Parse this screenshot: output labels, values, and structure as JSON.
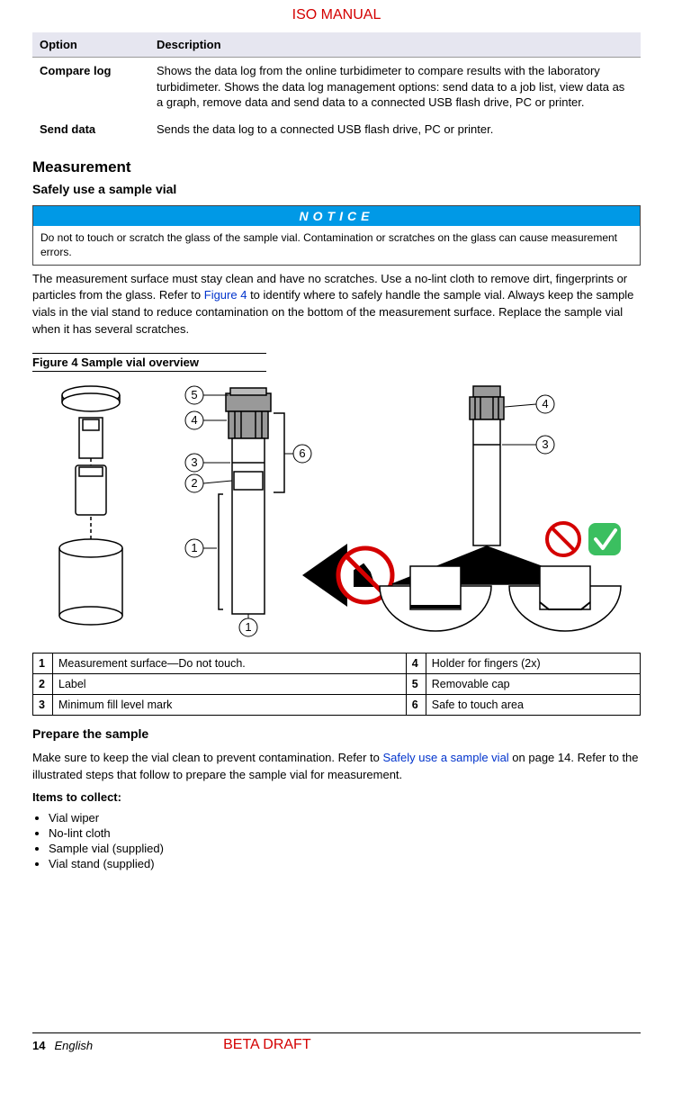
{
  "header": {
    "iso_label": "ISO MANUAL"
  },
  "options_table": {
    "headers": {
      "option": "Option",
      "description": "Description"
    },
    "rows": [
      {
        "name": "Compare log",
        "desc": "Shows the data log from the online turbidimeter to compare results with the laboratory turbidimeter. Shows the data log management options: send data to a job list, view data as a graph, remove data and send data to a connected USB flash drive, PC or printer."
      },
      {
        "name": "Send data",
        "desc": "Sends the data log to a connected USB flash drive, PC or printer."
      }
    ]
  },
  "section1": {
    "title": "Measurement",
    "subtitle": "Safely use a sample vial"
  },
  "notice": {
    "title": "NOTICE",
    "body": "Do not to touch or scratch the glass of the sample vial. Contamination or scratches on the glass can cause measurement errors."
  },
  "para1": {
    "pre": "The measurement surface must stay clean and have no scratches. Use a no-lint cloth to remove dirt, fingerprints or particles from the glass. Refer to ",
    "link": "Figure 4",
    "post": " to identify where to safely handle the sample vial. Always keep the sample vials in the vial stand to reduce contamination on the bottom of the measurement surface. Replace the sample vial when it has several scratches."
  },
  "figure": {
    "caption": "Figure 4  Sample vial overview",
    "callouts": {
      "c1": "1",
      "c2": "2",
      "c3": "3",
      "c4": "4",
      "c5": "5",
      "c6": "6"
    }
  },
  "legend": {
    "r1": {
      "n": "1",
      "t": "Measurement surface—Do not touch."
    },
    "r2": {
      "n": "2",
      "t": "Label"
    },
    "r3": {
      "n": "3",
      "t": "Minimum fill level mark"
    },
    "r4": {
      "n": "4",
      "t": "Holder for fingers (2x)"
    },
    "r5": {
      "n": "5",
      "t": "Removable cap"
    },
    "r6": {
      "n": "6",
      "t": "Safe to touch area"
    }
  },
  "section2": {
    "title": "Prepare the sample",
    "para_pre": "Make sure to keep the vial clean to prevent contamination. Refer to ",
    "para_link": "Safely use a sample vial",
    "para_post": " on page 14. Refer to the illustrated steps that follow to prepare the sample vial for measurement.",
    "items_title": "Items to collect:",
    "items": [
      "Vial wiper",
      "No-lint cloth",
      "Sample vial (supplied)",
      "Vial stand (supplied)"
    ]
  },
  "footer": {
    "page": "14",
    "lang": "English",
    "beta": "BETA DRAFT"
  }
}
